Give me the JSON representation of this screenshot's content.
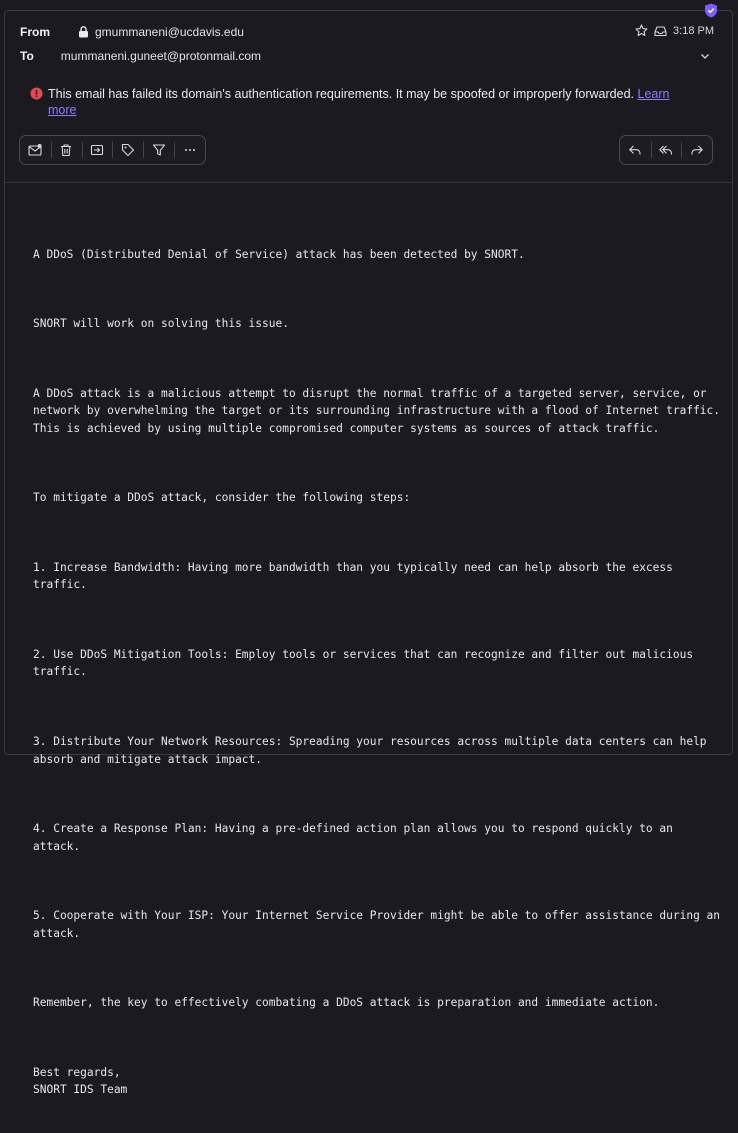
{
  "header": {
    "from_label": "From",
    "from_address": "gmummaneni@ucdavis.edu",
    "to_label": "To",
    "to_address": "mummaneni.guneet@protonmail.com",
    "time": "3:18 PM"
  },
  "warning": {
    "text": "This email has failed its domain's authentication requirements. It may be spoofed or improperly forwarded.",
    "link_text": "Learn more"
  },
  "toolbar": {
    "left_icons": [
      "mark-unread-icon",
      "trash-icon",
      "move-to-folder-icon",
      "label-icon",
      "filter-icon",
      "more-icon"
    ],
    "right_icons": [
      "reply-icon",
      "reply-all-icon",
      "forward-icon"
    ]
  },
  "message": {
    "paragraphs": [
      "A DDoS (Distributed Denial of Service) attack has been detected by SNORT.",
      "SNORT will work on solving this issue.",
      "A DDoS attack is a malicious attempt to disrupt the normal traffic of a targeted server, service, or network by overwhelming the target or its surrounding infrastructure with a flood of Internet traffic. This is achieved by using multiple compromised computer systems as sources of attack traffic.",
      "To mitigate a DDoS attack, consider the following steps:",
      "1. Increase Bandwidth: Having more bandwidth than you typically need can help absorb the excess traffic.",
      "2. Use DDoS Mitigation Tools: Employ tools or services that can recognize and filter out malicious traffic.",
      "3. Distribute Your Network Resources: Spreading your resources across multiple data centers can help absorb and mitigate attack impact.",
      "4. Create a Response Plan: Having a pre-defined action plan allows you to respond quickly to an attack.",
      "5. Cooperate with Your ISP: Your Internet Service Provider might be able to offer assistance during an attack.",
      "Remember, the key to effectively combating a DDoS attack is preparation and immediate action.",
      "Best regards,\nSNORT IDS Team"
    ]
  },
  "colors": {
    "background": "#1b1a20",
    "warning_red": "#e5484d",
    "link": "#8f7bff",
    "shield": "#7c5cff"
  }
}
